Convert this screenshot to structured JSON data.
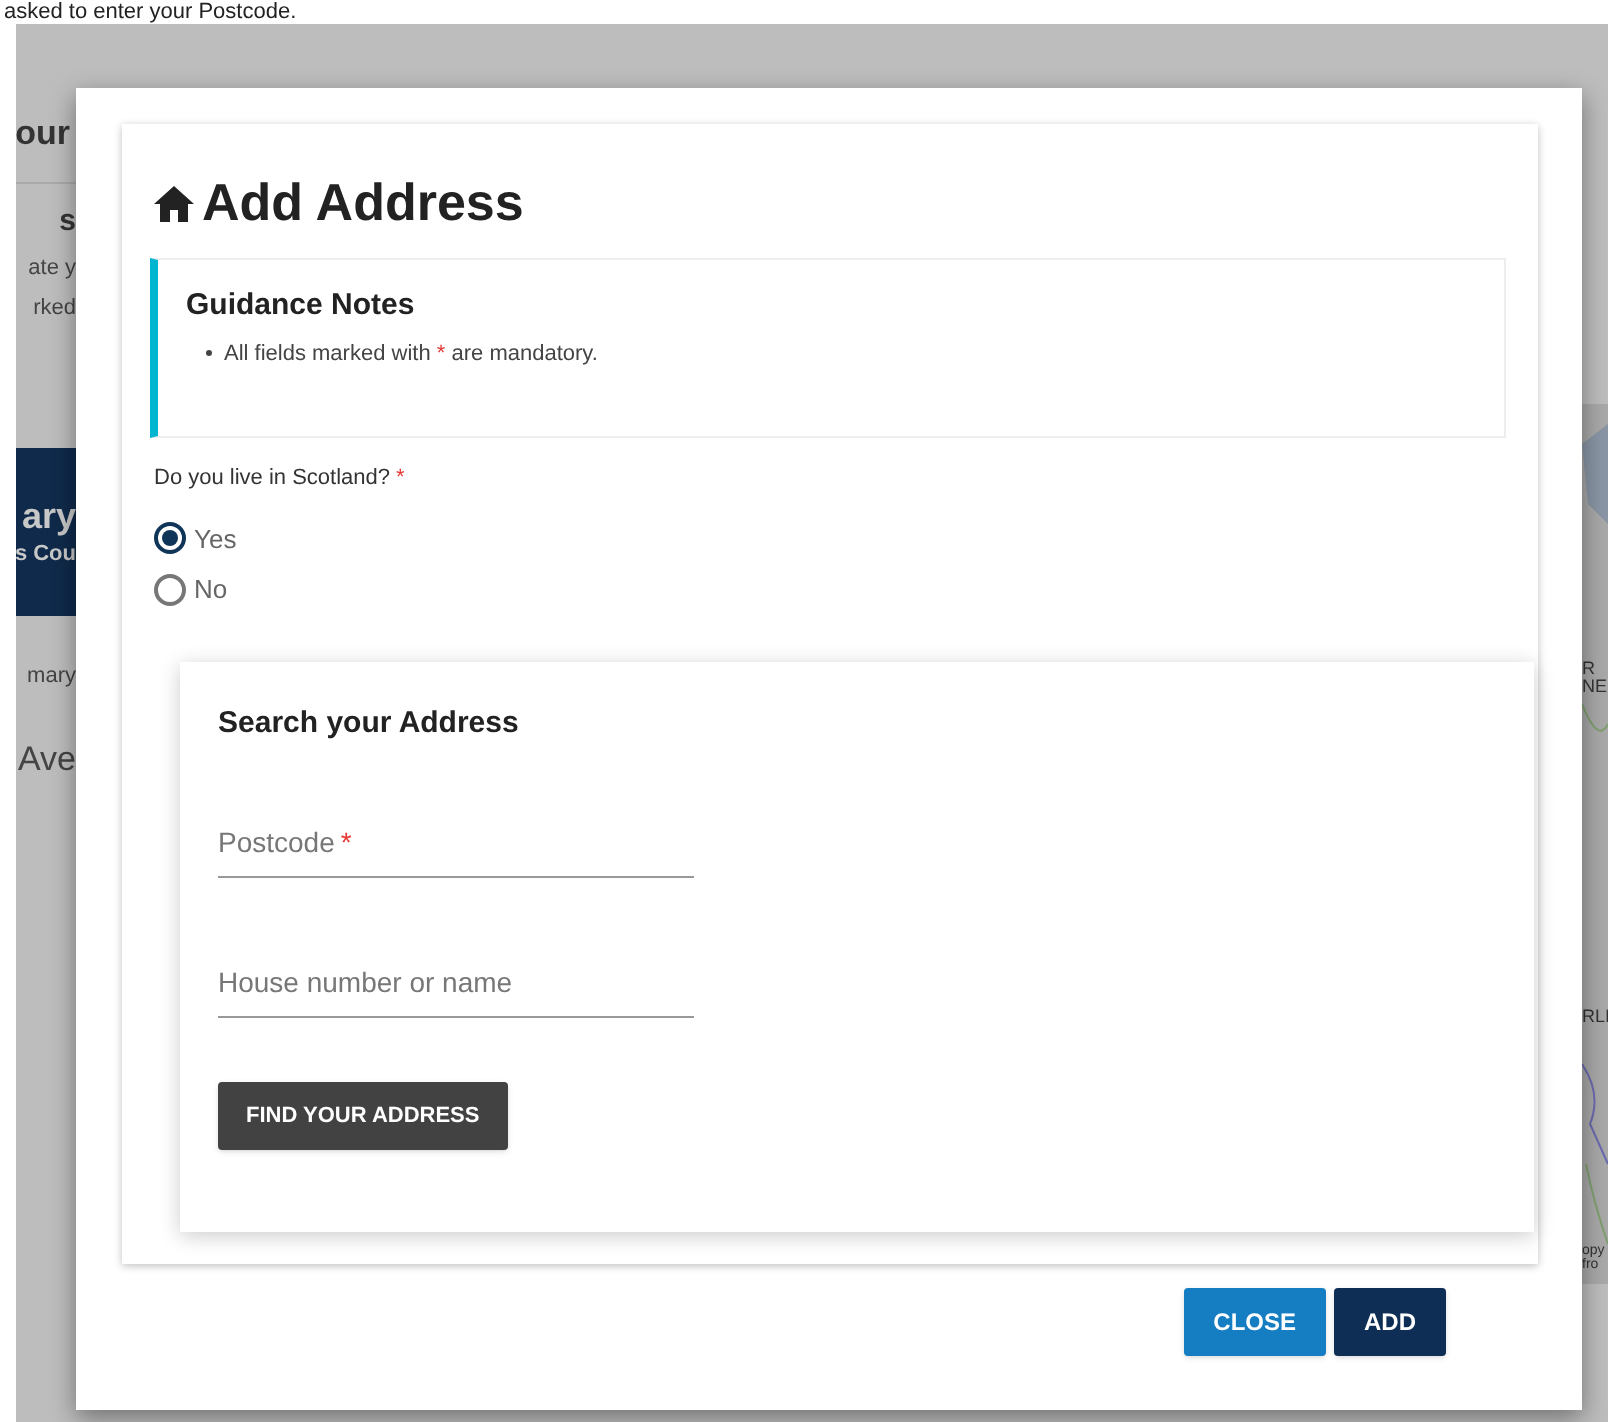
{
  "page_heading": "asked to enter your Postcode.",
  "background_fragments": [
    {
      "kind": "title",
      "text": "our"
    },
    {
      "kind": "subtitle",
      "text": "s"
    },
    {
      "kind": "line",
      "text": "ate y"
    },
    {
      "kind": "line",
      "text": "rked"
    },
    {
      "kind": "banner",
      "text": "ary",
      "subtext": "s Cou"
    },
    {
      "kind": "line",
      "text": "mary"
    },
    {
      "kind": "large",
      "text": "Ave"
    }
  ],
  "map_labels": [
    "R",
    "NE",
    "RLI",
    "opy",
    "fro"
  ],
  "dialog": {
    "title": "Add Address",
    "guidance": {
      "title": "Guidance Notes",
      "items": [
        {
          "before": "All fields marked with",
          "mark": "*",
          "after": "are mandatory."
        }
      ]
    },
    "question": {
      "label": "Do you live in Scotland?",
      "required_mark": "*",
      "options": [
        {
          "label": "Yes",
          "selected": true
        },
        {
          "label": "No",
          "selected": false
        }
      ]
    },
    "search_card": {
      "title": "Search your Address",
      "fields": [
        {
          "placeholder": "Postcode",
          "required_mark": "*"
        },
        {
          "placeholder": "House number or name"
        }
      ],
      "button": "FIND YOUR ADDRESS"
    },
    "buttons": [
      {
        "label": "CLOSE",
        "kind": "secondary"
      },
      {
        "label": "ADD",
        "kind": "primary"
      }
    ]
  }
}
